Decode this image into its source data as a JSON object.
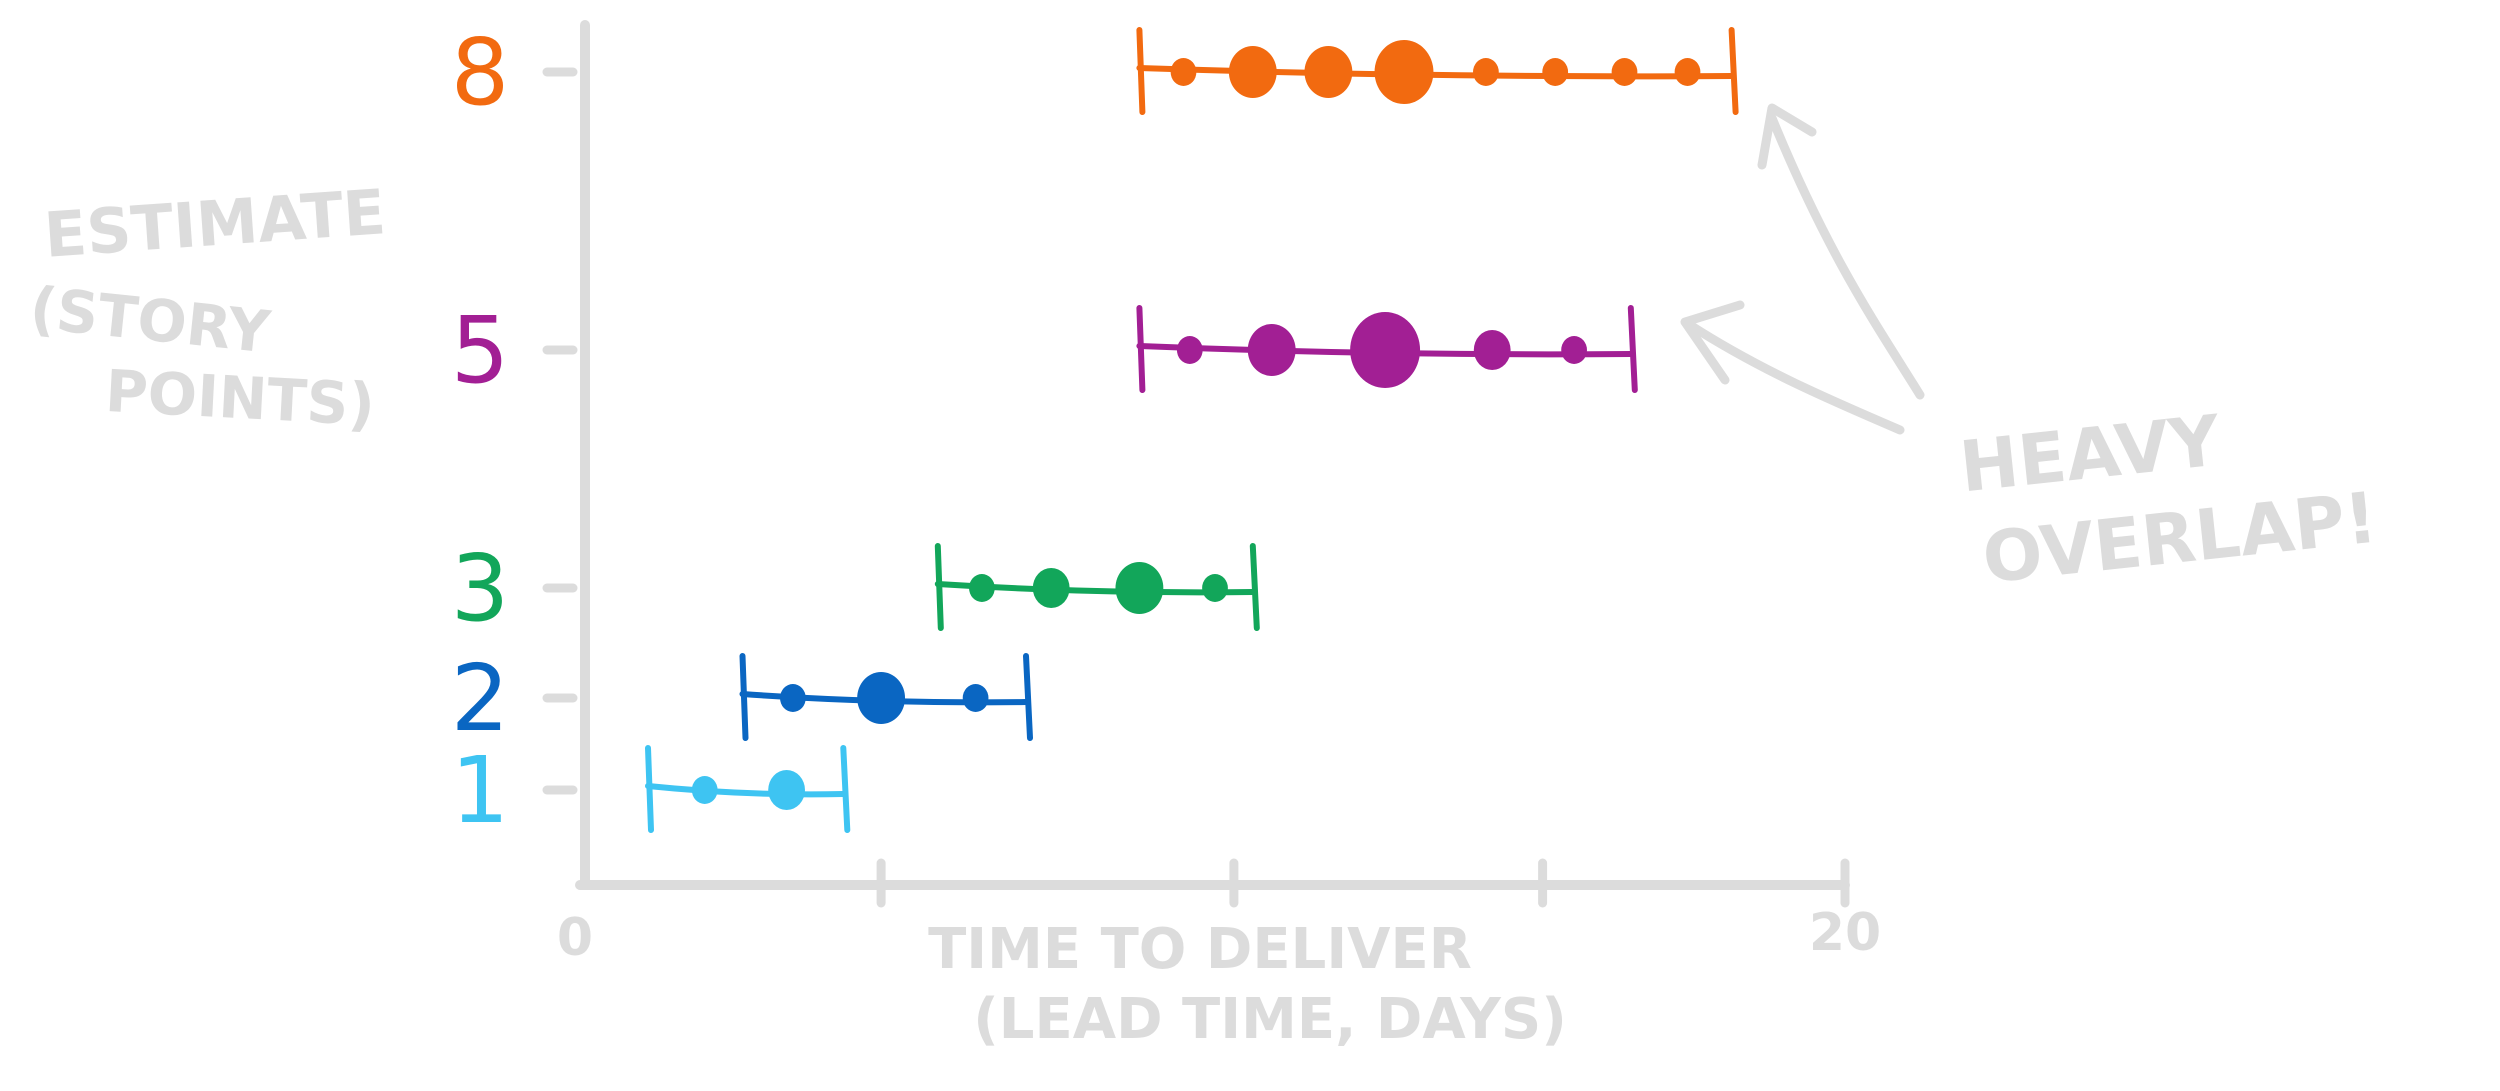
{
  "chart_data": {
    "type": "scatter",
    "title": "",
    "xlabel_line1": "TIME TO DELIVER",
    "xlabel_line2": "(LEAD TIME, DAYS)",
    "ylabel_line1": "ESTIMATE",
    "ylabel_line2": "(STORY",
    "ylabel_line3": "POINTS)",
    "xlim": [
      0,
      20
    ],
    "x_tick_labels": [
      "0",
      "20"
    ],
    "x_tick_positions": [
      0,
      4.7,
      10.3,
      15.2,
      20
    ],
    "annotation_line1": "HEAVY",
    "annotation_line2": "OVERLAP!",
    "series": [
      {
        "name": "1",
        "estimate": 1,
        "color": "#3ec4f2",
        "range": [
          1.0,
          4.1
        ],
        "points": [
          {
            "x": 1.9,
            "weight": 1
          },
          {
            "x": 3.2,
            "weight": 2
          }
        ]
      },
      {
        "name": "2",
        "estimate": 2,
        "color": "#0a66c2",
        "range": [
          2.5,
          7.0
        ],
        "points": [
          {
            "x": 3.3,
            "weight": 1
          },
          {
            "x": 4.7,
            "weight": 3
          },
          {
            "x": 6.2,
            "weight": 1
          }
        ]
      },
      {
        "name": "3",
        "estimate": 3,
        "color": "#12a65a",
        "range": [
          5.6,
          10.6
        ],
        "points": [
          {
            "x": 6.3,
            "weight": 1
          },
          {
            "x": 7.4,
            "weight": 2
          },
          {
            "x": 8.8,
            "weight": 3
          },
          {
            "x": 10.0,
            "weight": 1
          }
        ]
      },
      {
        "name": "5",
        "estimate": 5,
        "color": "#a21f94",
        "range": [
          8.8,
          16.6
        ],
        "points": [
          {
            "x": 9.6,
            "weight": 1
          },
          {
            "x": 10.9,
            "weight": 3
          },
          {
            "x": 12.7,
            "weight": 5
          },
          {
            "x": 14.4,
            "weight": 2
          },
          {
            "x": 15.7,
            "weight": 1
          }
        ]
      },
      {
        "name": "8",
        "estimate": 8,
        "color": "#f26a10",
        "range": [
          8.8,
          18.2
        ],
        "points": [
          {
            "x": 9.5,
            "weight": 1
          },
          {
            "x": 10.6,
            "weight": 3
          },
          {
            "x": 11.8,
            "weight": 3
          },
          {
            "x": 13.0,
            "weight": 4
          },
          {
            "x": 14.3,
            "weight": 1
          },
          {
            "x": 15.4,
            "weight": 1
          },
          {
            "x": 16.5,
            "weight": 1
          },
          {
            "x": 17.5,
            "weight": 1
          }
        ]
      }
    ]
  }
}
